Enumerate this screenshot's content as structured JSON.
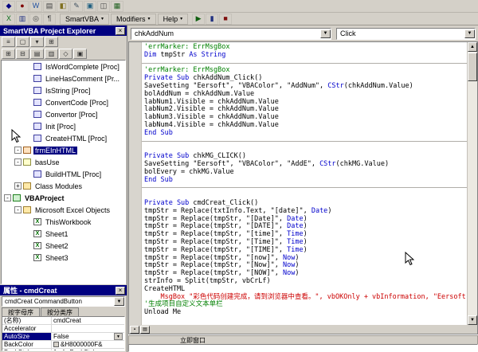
{
  "icons": {
    "chevron_down": "▼",
    "menu_arrow": "▾",
    "close": "×",
    "scroll_up": "▲",
    "scroll_down": "▼",
    "proc_view": "▪",
    "module_view": "▤"
  },
  "top_toolbar": {
    "row1": [
      {
        "name": "font-format-icon",
        "glyph": "◆",
        "color": "#000080"
      },
      {
        "name": "char-format-icon",
        "glyph": "●",
        "color": "#800000"
      },
      {
        "name": "word-doc-icon",
        "glyph": "W",
        "color": "#2050a0"
      },
      {
        "name": "list-icon",
        "glyph": "▤",
        "color": "#404040"
      },
      {
        "name": "palette-icon",
        "glyph": "◧",
        "color": "#807020"
      },
      {
        "name": "edit-icon",
        "glyph": "✎",
        "color": "#405060"
      },
      {
        "name": "stamp-icon",
        "glyph": "▣",
        "color": "#206080"
      },
      {
        "name": "panels-icon",
        "glyph": "◫",
        "color": "#404040"
      },
      {
        "name": "grid-icon",
        "glyph": "▦",
        "color": "#206020"
      }
    ],
    "row2_left": [
      {
        "name": "excel-icon",
        "glyph": "X",
        "color": "#107020"
      },
      {
        "name": "save-icon",
        "glyph": "▥",
        "color": "#203080"
      },
      {
        "name": "search-icon",
        "glyph": "◎",
        "color": "#404040"
      },
      {
        "name": "paragraph-icon",
        "glyph": "¶",
        "color": "#404040"
      }
    ],
    "menus": [
      {
        "label": "SmartVBA"
      },
      {
        "label": "Modifiers"
      },
      {
        "label": "Help"
      }
    ],
    "row2_right": [
      {
        "name": "run-icon",
        "glyph": "▶",
        "color": "#106010"
      },
      {
        "name": "pause-icon",
        "glyph": "▮",
        "color": "#203080"
      },
      {
        "name": "stop-icon",
        "glyph": "■",
        "color": "#801010"
      }
    ]
  },
  "explorer": {
    "title": "SmartVBA Project Explorer",
    "toolbar_row1": [
      {
        "name": "view-code-icon",
        "glyph": "≡",
        "color": "#303030"
      },
      {
        "name": "view-object-icon",
        "glyph": "▢",
        "color": "#303030"
      },
      {
        "name": "dropdown-icon",
        "glyph": "▾",
        "color": "#303030"
      },
      {
        "name": "folders-icon",
        "glyph": "⊞",
        "color": "#303030"
      }
    ],
    "toolbar_row2": [
      {
        "name": "expand-all-icon",
        "glyph": "⊞",
        "color": "#303030"
      },
      {
        "name": "collapse-all-icon",
        "glyph": "⊟",
        "color": "#303030"
      },
      {
        "name": "list-view-icon",
        "glyph": "▤",
        "color": "#303030"
      },
      {
        "name": "detail-view-icon",
        "glyph": "▥",
        "color": "#303030"
      },
      {
        "name": "filter-icon",
        "glyph": "◇",
        "color": "#303030"
      },
      {
        "name": "props-icon",
        "glyph": "▣",
        "color": "#303030"
      }
    ],
    "tree": [
      {
        "depth": 2,
        "icon": "proc",
        "label": "IsWordComplete [Proc]"
      },
      {
        "depth": 2,
        "icon": "proc",
        "label": "LineHasComment [Pr..."
      },
      {
        "depth": 2,
        "icon": "proc",
        "label": "IsString [Proc]"
      },
      {
        "depth": 2,
        "icon": "proc",
        "label": "ConvertCode [Proc]"
      },
      {
        "depth": 2,
        "icon": "proc",
        "label": "Convertor [Proc]"
      },
      {
        "depth": 2,
        "icon": "proc",
        "label": "Init [Proc]"
      },
      {
        "depth": 2,
        "icon": "proc",
        "label": "CreateHTML [Proc]"
      },
      {
        "depth": 1,
        "icon": "form",
        "label": "frmEInHTML",
        "selected": true,
        "expander": "-"
      },
      {
        "depth": 1,
        "icon": "module",
        "label": "basUse",
        "expander": "-"
      },
      {
        "depth": 2,
        "icon": "proc",
        "label": "BuildHTML [Proc]"
      },
      {
        "depth": 1,
        "icon": "folder",
        "label": "Class Modules",
        "expander": "+"
      },
      {
        "depth": 0,
        "icon": "project",
        "label": "VBAProject",
        "bold": true,
        "expander": "-"
      },
      {
        "depth": 1,
        "icon": "folder",
        "label": "Microsoft Excel Objects",
        "expander": "-"
      },
      {
        "depth": 2,
        "icon": "workbook",
        "label": "ThisWorkbook"
      },
      {
        "depth": 2,
        "icon": "sheet",
        "label": "Sheet1"
      },
      {
        "depth": 2,
        "icon": "sheet",
        "label": "Sheet2"
      },
      {
        "depth": 2,
        "icon": "sheet",
        "label": "Sheet3"
      }
    ]
  },
  "properties": {
    "title": "属性 - cmdCreat",
    "object_selector": "cmdCreat CommandButton",
    "tabs": [
      "按字母序",
      "按分类序"
    ],
    "rows": [
      {
        "name": "(名称)",
        "value": "cmdCreat"
      },
      {
        "name": "Accelerator",
        "value": ""
      },
      {
        "name": "AutoSize",
        "value": "False",
        "selected": true,
        "combo": true
      },
      {
        "name": "BackColor",
        "value": "&H8000000F&",
        "swatch": true
      },
      {
        "name": "BackStyle",
        "value": "1 - fmBackStyl"
      }
    ]
  },
  "code": {
    "object_dropdown": "chkAddNum",
    "event_dropdown": "Click",
    "lines": [
      {
        "t": [
          [
            "c",
            "'errMarker: ErrMsgBox"
          ]
        ]
      },
      {
        "t": [
          [
            "k",
            "Dim"
          ],
          [
            "n",
            " tmpStr "
          ],
          [
            "k",
            "As String"
          ]
        ]
      },
      {
        "t": [],
        "sep": true
      },
      {
        "t": [
          [
            "c",
            "'errMarker: ErrMsgBox"
          ]
        ]
      },
      {
        "t": [
          [
            "k",
            "Private Sub"
          ],
          [
            "n",
            " chkAddNum_Click()"
          ]
        ]
      },
      {
        "t": [
          [
            "n",
            "SaveSetting \"Eersoft\", \"VBAColor\", \"AddNum\", "
          ],
          [
            "k",
            "CStr"
          ],
          [
            "n",
            "(chkAddNum.Value)"
          ]
        ]
      },
      {
        "t": [
          [
            "n",
            "bolAddNum = chkAddNum.Value"
          ]
        ]
      },
      {
        "t": [
          [
            "n",
            "labNum1.Visible = chkAddNum.Value"
          ]
        ]
      },
      {
        "t": [
          [
            "n",
            "labNum2.Visible = chkAddNum.Value"
          ]
        ]
      },
      {
        "t": [
          [
            "n",
            "labNum3.Visible = chkAddNum.Value"
          ]
        ]
      },
      {
        "t": [
          [
            "n",
            "labNum4.Visible = chkAddNum.Value"
          ]
        ]
      },
      {
        "t": [
          [
            "k",
            "End Sub"
          ]
        ]
      },
      {
        "t": [],
        "sep": true
      },
      {
        "t": []
      },
      {
        "t": [
          [
            "k",
            "Private Sub"
          ],
          [
            "n",
            " chkMG_CLICK()"
          ]
        ]
      },
      {
        "t": [
          [
            "n",
            "SaveSetting \"Eersoft\", \"VBAColor\", \"AddE\", "
          ],
          [
            "k",
            "CStr"
          ],
          [
            "n",
            "(chkMG.Value)"
          ]
        ]
      },
      {
        "t": [
          [
            "n",
            "bolEvery = chkMG.Value"
          ]
        ]
      },
      {
        "t": [
          [
            "k",
            "End Sub"
          ]
        ]
      },
      {
        "t": [],
        "sep": true
      },
      {
        "t": []
      },
      {
        "t": [
          [
            "k",
            "Private Sub"
          ],
          [
            "n",
            " cmdCreat_Click()"
          ]
        ]
      },
      {
        "t": [
          [
            "n",
            "tmpStr = Replace(txtInfo.Text, \"[date]\", "
          ],
          [
            "k",
            "Date"
          ],
          [
            "n",
            ")"
          ]
        ]
      },
      {
        "t": [
          [
            "n",
            "tmpStr = Replace(tmpStr, \"[Date]\", "
          ],
          [
            "k",
            "Date"
          ],
          [
            "n",
            ")"
          ]
        ]
      },
      {
        "t": [
          [
            "n",
            "tmpStr = Replace(tmpStr, \"[DATE]\", "
          ],
          [
            "k",
            "Date"
          ],
          [
            "n",
            ")"
          ]
        ]
      },
      {
        "t": [
          [
            "n",
            "tmpStr = Replace(tmpStr, \"[time]\", "
          ],
          [
            "k",
            "Time"
          ],
          [
            "n",
            ")"
          ]
        ]
      },
      {
        "t": [
          [
            "n",
            "tmpStr = Replace(tmpStr, \"[Time]\", "
          ],
          [
            "k",
            "Time"
          ],
          [
            "n",
            ")"
          ]
        ]
      },
      {
        "t": [
          [
            "n",
            "tmpStr = Replace(tmpStr, \"[TIME]\", "
          ],
          [
            "k",
            "Time"
          ],
          [
            "n",
            ")"
          ]
        ]
      },
      {
        "t": [
          [
            "n",
            "tmpStr = Replace(tmpStr, \"[now]\", "
          ],
          [
            "k",
            "Now"
          ],
          [
            "n",
            ")"
          ]
        ]
      },
      {
        "t": [
          [
            "n",
            "tmpStr = Replace(tmpStr, \"[Now]\", "
          ],
          [
            "k",
            "Now"
          ],
          [
            "n",
            ")"
          ]
        ]
      },
      {
        "t": [
          [
            "n",
            "tmpStr = Replace(tmpStr, \"[NOW]\", "
          ],
          [
            "k",
            "Now"
          ],
          [
            "n",
            ")"
          ]
        ]
      },
      {
        "t": [
          [
            "n",
            "strInfo = Split(tmpStr, vbCrLf)"
          ]
        ]
      },
      {
        "t": [
          [
            "n",
            "CreateHTML"
          ]
        ]
      },
      {
        "t": [
          [
            "r",
            "    MsgBox \"彩色代码创建完成，请到浏览器中查看。\", vbOKOnly + vbInformation, \"Eersoft-提示\""
          ]
        ]
      },
      {
        "t": [
          [
            "c",
            "'生成项目自定义文本单栏"
          ]
        ]
      },
      {
        "t": [
          [
            "n",
            "Unload Me"
          ]
        ]
      }
    ]
  },
  "immediate": {
    "title": "立即窗口"
  }
}
